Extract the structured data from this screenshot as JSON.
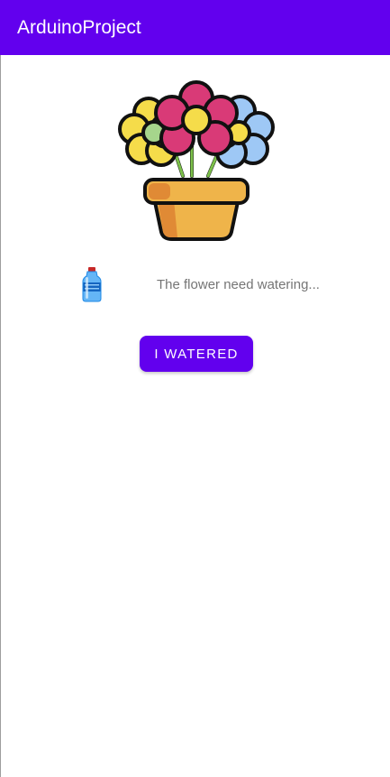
{
  "app_bar": {
    "title": "ArduinoProject",
    "color": "#6200ee"
  },
  "main": {
    "image_icon": "flower-pot-icon",
    "status_icon": "water-bottle-icon",
    "status_text": "The flower need watering...",
    "button_label": "I WATERED"
  }
}
